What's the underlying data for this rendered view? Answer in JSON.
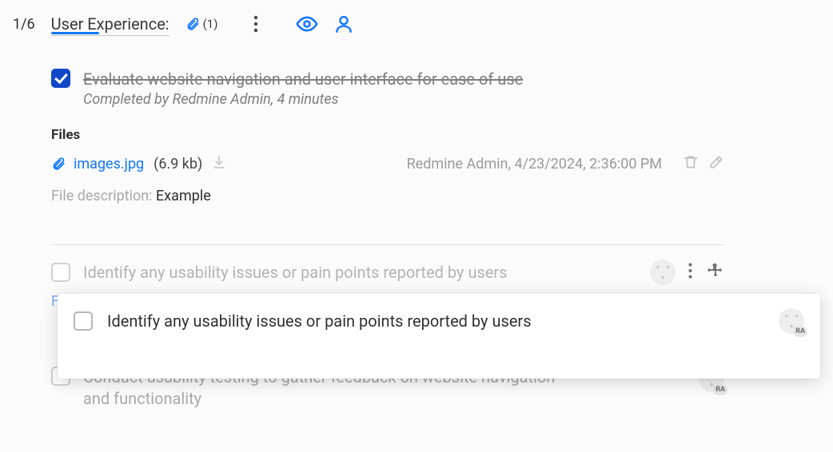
{
  "counter": "1/6",
  "title": "User Experience:",
  "attachment_count": "(1)",
  "task1": {
    "checked": true,
    "title": "Evaluate website navigation and user interface for ease of use",
    "meta": "Completed by Redmine Admin, 4 minutes"
  },
  "files": {
    "heading": "Files",
    "items": [
      {
        "name": "images.jpg",
        "size": "(6.9 kb)",
        "meta": "Redmine Admin, 4/23/2024, 2:36:00 PM"
      }
    ],
    "description_label": "File description: ",
    "description_value": "Example"
  },
  "ghost_row_title": "Identify any usability issues or pain points reported by users",
  "floating_title": "Identify any usability issues or pain points reported by users",
  "row3_title": "Conduct usability testing to gather feedback on website navigation and functionality",
  "avatar_initials": "RA",
  "partial_label": "F"
}
